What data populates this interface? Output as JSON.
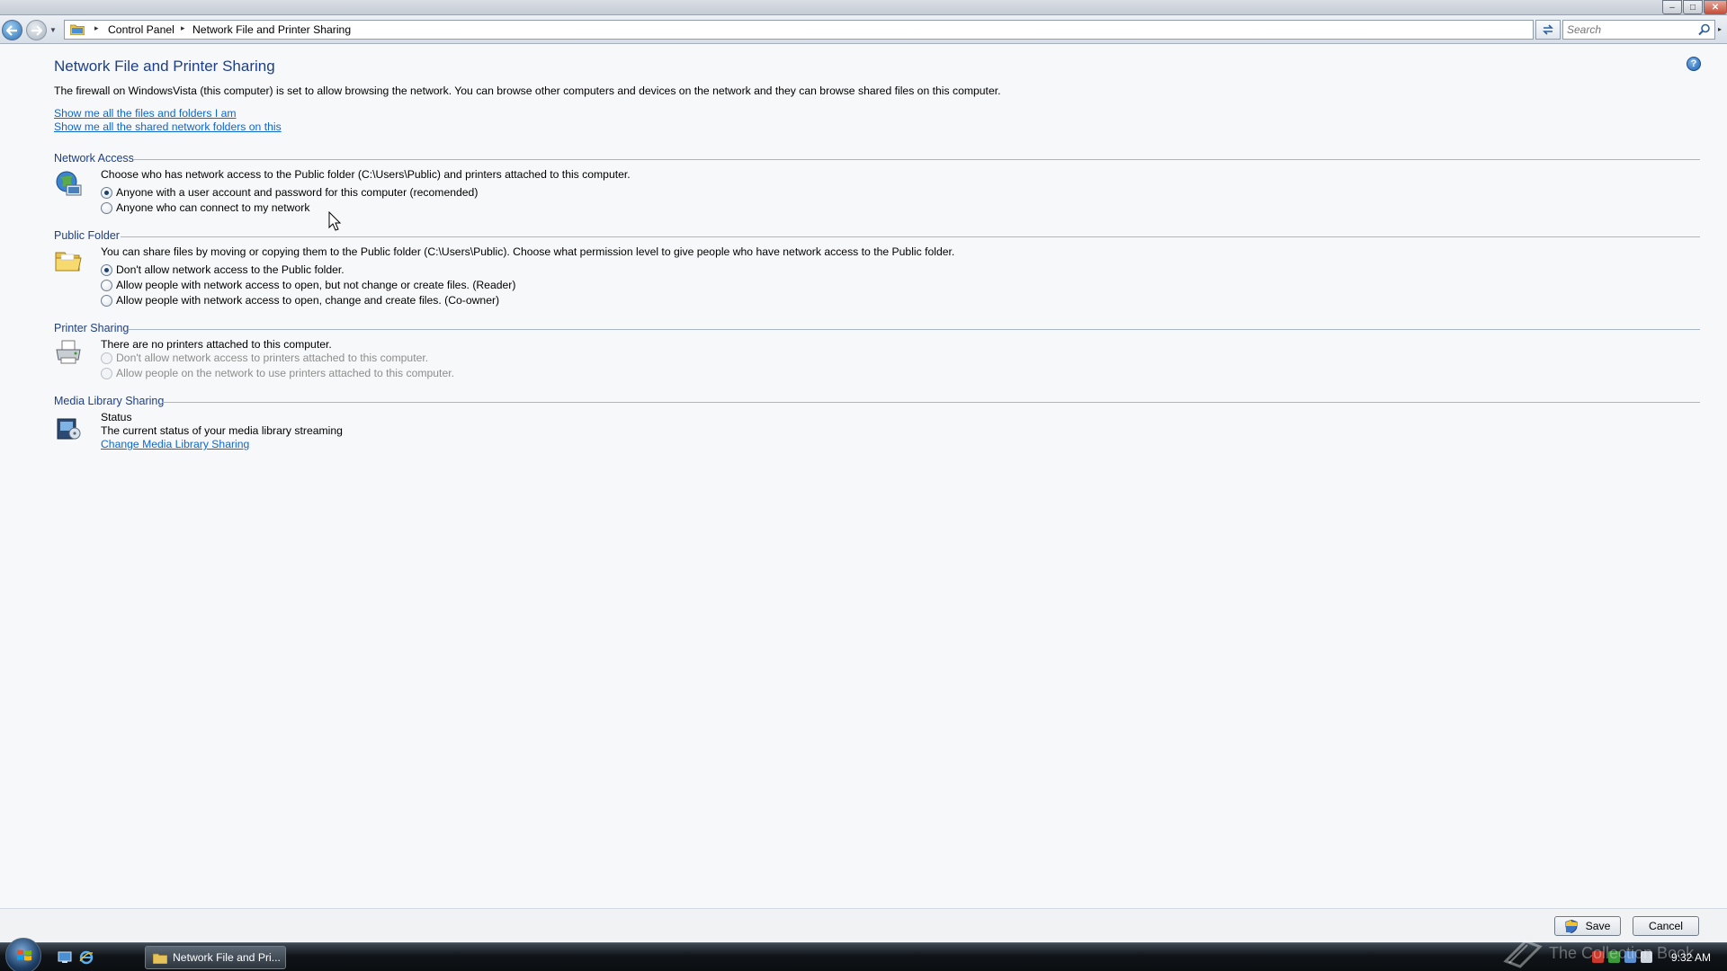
{
  "window": {
    "controls": {
      "minimize": "–",
      "maximize": "□",
      "close": "✕"
    }
  },
  "address_bar": {
    "crumbs": [
      "Control Panel",
      "Network File and Printer Sharing"
    ],
    "search_placeholder": "Search"
  },
  "page": {
    "title": "Network File and Printer Sharing",
    "intro": "The firewall on WindowsVista (this computer) is set to allow browsing the network.  You can browse other computers and devices on the network and they can browse shared files on this computer.",
    "links": [
      "Show me all the files and folders I am",
      "Show me all the shared network folders on this"
    ],
    "help_glyph": "?"
  },
  "sections": {
    "network_access": {
      "heading": "Network Access",
      "description": "Choose who has network access to the Public folder (C:\\Users\\Public) and printers attached to this computer.",
      "options": [
        {
          "label": "Anyone with a user account and password for this computer (recomended)",
          "selected": true
        },
        {
          "label": "Anyone who can connect to my network",
          "selected": false
        }
      ]
    },
    "public_folder": {
      "heading": "Public Folder",
      "description": "You can share files by moving or copying them to the Public folder (C:\\Users\\Public).  Choose what permission level to give people who have network access to the Public folder.",
      "options": [
        {
          "label": "Don't allow network access to the Public folder.",
          "selected": true
        },
        {
          "label": "Allow people with network access to open, but not change or create files. (Reader)",
          "selected": false
        },
        {
          "label": "Allow people with network access to open, change and create files. (Co-owner)",
          "selected": false
        }
      ]
    },
    "printer_sharing": {
      "heading": "Printer Sharing",
      "description": "There are no printers attached to this computer.",
      "options": [
        {
          "label": "Don't allow network access to printers attached to this computer.",
          "selected": false,
          "disabled": true
        },
        {
          "label": "Allow people on the network to use printers attached to this computer.",
          "selected": false,
          "disabled": true
        }
      ]
    },
    "media_library": {
      "heading": "Media Library Sharing",
      "status_label": "Status",
      "status_text": "The current status of your media library streaming",
      "link": "Change Media Library Sharing"
    }
  },
  "buttons": {
    "save": "Save",
    "cancel": "Cancel"
  },
  "taskbar": {
    "task_label": "Network File and Pri...",
    "clock": "9:32 AM"
  },
  "watermark": "The Collection Book",
  "colors": {
    "heading_blue": "#1e3f86",
    "link_blue": "#1166cc",
    "section_rule": "#a9b6c6"
  }
}
